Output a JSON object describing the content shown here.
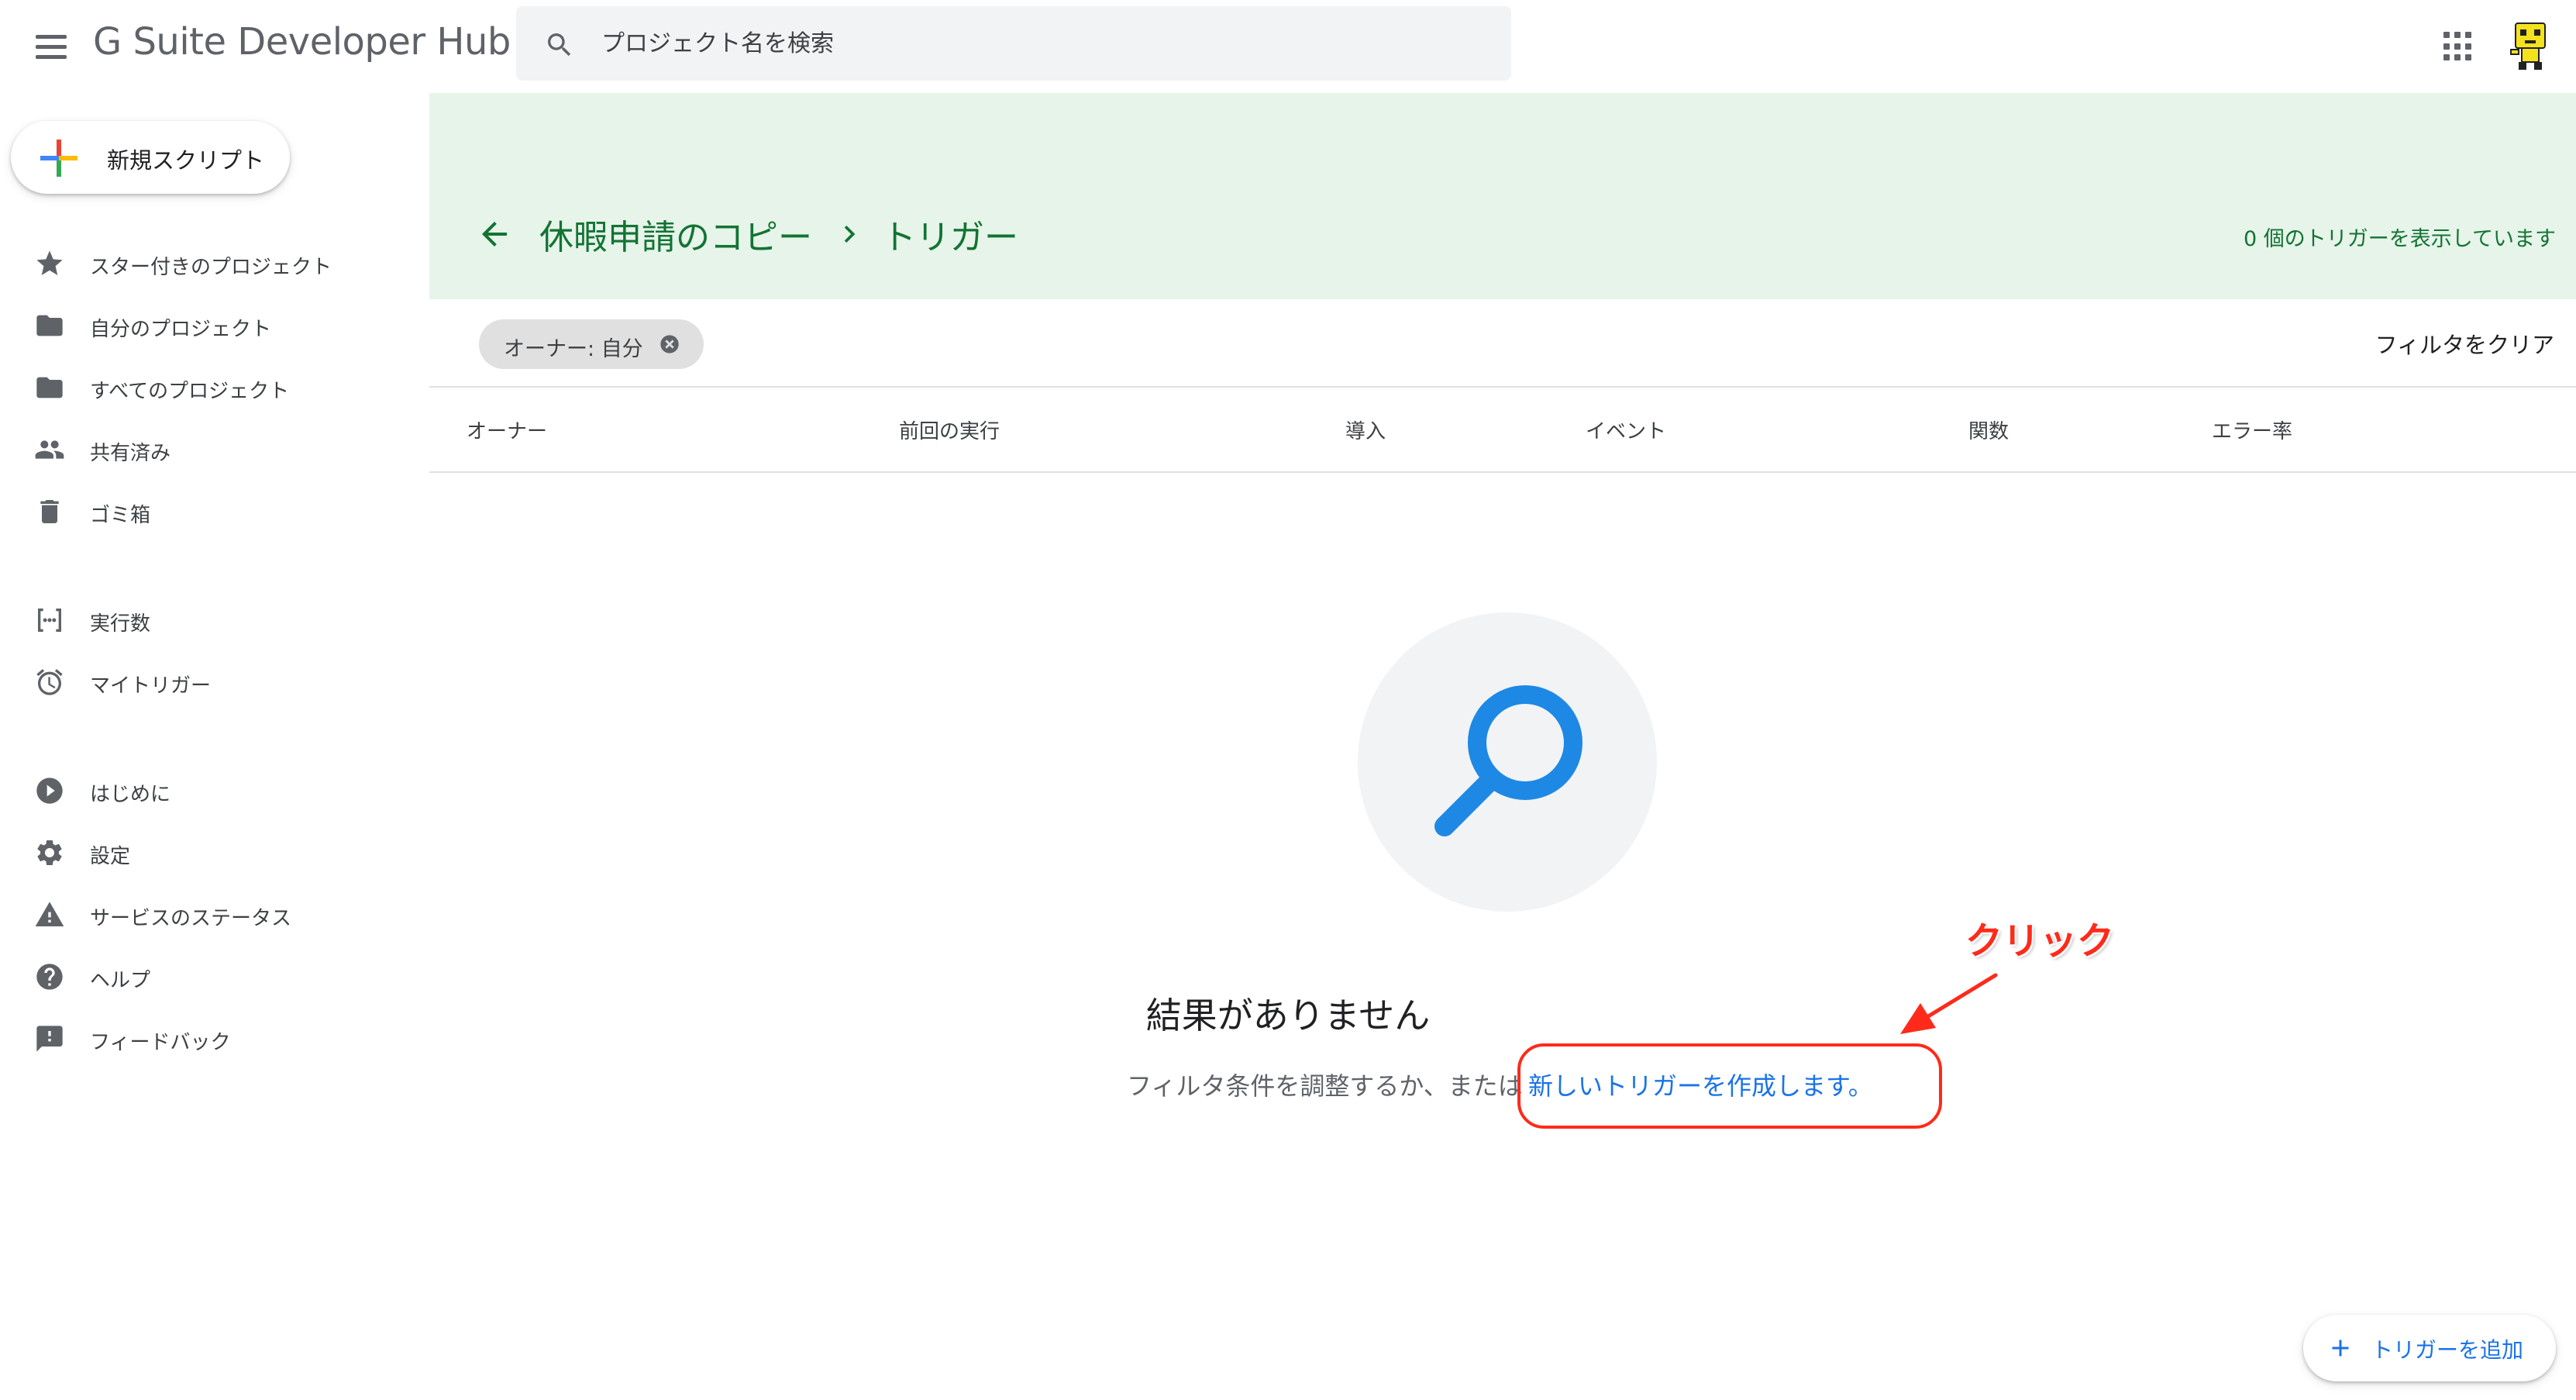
{
  "app": {
    "title": "G Suite Developer Hub"
  },
  "search": {
    "placeholder": "プロジェクト名を検索"
  },
  "sidebar": {
    "new_script_label": "新規スクリプト",
    "items": [
      {
        "label": "スター付きのプロジェクト",
        "icon": "star-icon"
      },
      {
        "label": "自分のプロジェクト",
        "icon": "folder-icon"
      },
      {
        "label": "すべてのプロジェクト",
        "icon": "folder-icon"
      },
      {
        "label": "共有済み",
        "icon": "people-icon"
      },
      {
        "label": "ゴミ箱",
        "icon": "trash-icon"
      },
      {
        "label": "実行数",
        "icon": "executions-icon"
      },
      {
        "label": "マイトリガー",
        "icon": "alarm-clock-icon"
      },
      {
        "label": "はじめに",
        "icon": "play-circle-icon"
      },
      {
        "label": "設定",
        "icon": "gear-icon"
      },
      {
        "label": "サービスのステータス",
        "icon": "warning-icon"
      },
      {
        "label": "ヘルプ",
        "icon": "help-icon"
      },
      {
        "label": "フィードバック",
        "icon": "feedback-icon"
      }
    ]
  },
  "header": {
    "project_name": "休暇申請のコピー",
    "current_page": "トリガー",
    "trigger_count_text": "0 個のトリガーを表示しています",
    "band_color": "#e6f4ea",
    "text_color": "#137333"
  },
  "filters": {
    "chip_label": "オーナー: 自分",
    "clear_label": "フィルタをクリア"
  },
  "table": {
    "columns": [
      "オーナー",
      "前回の実行",
      "導入",
      "イベント",
      "関数",
      "エラー率"
    ]
  },
  "empty_state": {
    "title": "結果がありません",
    "message": "フィルタ条件を調整するか、または",
    "link_text": "新しいトリガーを作成します。",
    "icon": "magnifier-icon"
  },
  "annotation": {
    "label": "クリック",
    "color": "#ff2a1a"
  },
  "fab": {
    "label": "トリガーを追加"
  },
  "colors": {
    "accent": "#1a73e8",
    "icon_gray": "#5f6368"
  }
}
